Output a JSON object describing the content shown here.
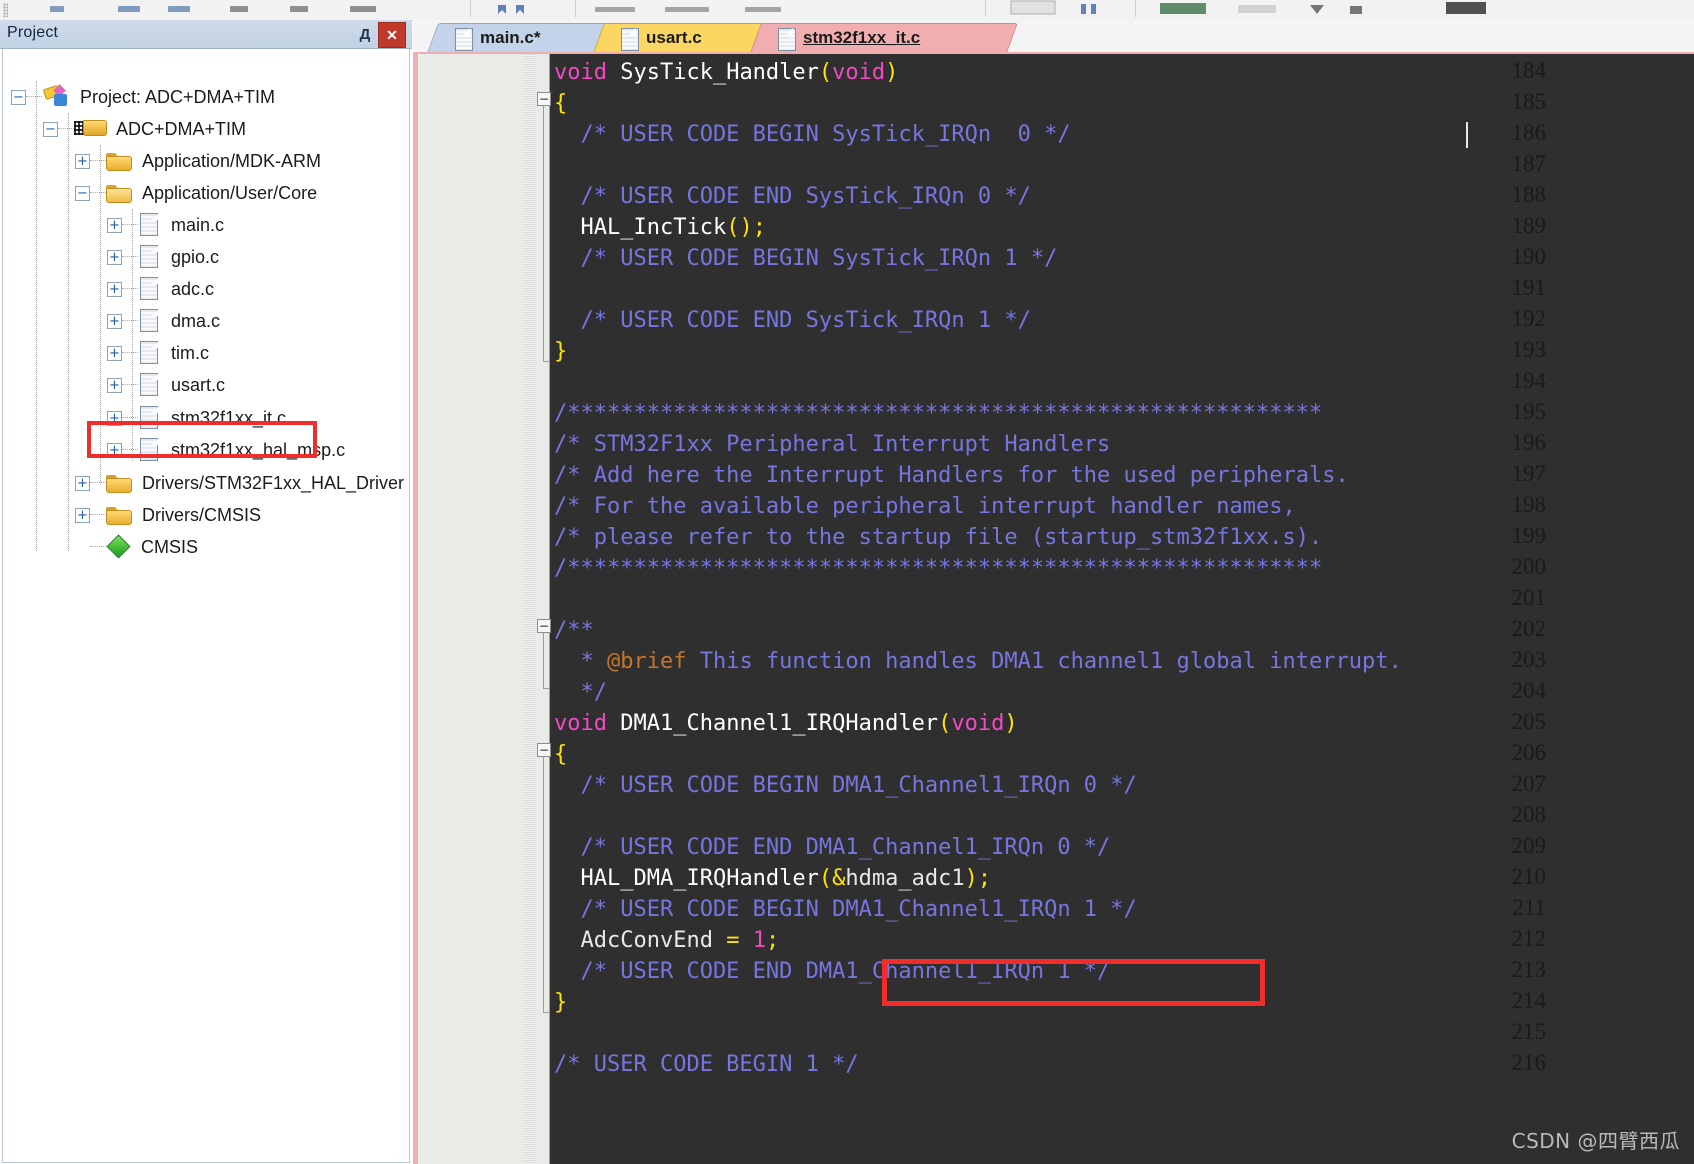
{
  "window": {
    "app": "Keil uVision MDK-ARM"
  },
  "toolbar": {
    "name": "main-toolbar-cropped"
  },
  "project_panel": {
    "title": "Project",
    "pin_label": "Д",
    "close_label": "✕",
    "pin_icon": "pin-icon",
    "close_icon": "close-icon",
    "tree": [
      {
        "label": "Project: ADC+DMA+TIM",
        "indent": 0,
        "expander": "−",
        "icon": "project-icon"
      },
      {
        "label": "ADC+DMA+TIM",
        "indent": 1,
        "expander": "−",
        "icon": "target-group-icon"
      },
      {
        "label": "Application/MDK-ARM",
        "indent": 2,
        "expander": "+",
        "icon": "folder-icon"
      },
      {
        "label": "Application/User/Core",
        "indent": 2,
        "expander": "−",
        "icon": "folder-open-icon"
      },
      {
        "label": "main.c",
        "indent": 3,
        "expander": "+",
        "icon": "file-icon"
      },
      {
        "label": "gpio.c",
        "indent": 3,
        "expander": "+",
        "icon": "file-icon"
      },
      {
        "label": "adc.c",
        "indent": 3,
        "expander": "+",
        "icon": "file-icon"
      },
      {
        "label": "dma.c",
        "indent": 3,
        "expander": "+",
        "icon": "file-icon"
      },
      {
        "label": "tim.c",
        "indent": 3,
        "expander": "+",
        "icon": "file-icon"
      },
      {
        "label": "usart.c",
        "indent": 3,
        "expander": "+",
        "icon": "file-icon"
      },
      {
        "label": "stm32f1xx_it.c",
        "indent": 3,
        "expander": "+",
        "icon": "file-icon"
      },
      {
        "label": "stm32f1xx_hal_msp.c",
        "indent": 3,
        "expander": "+",
        "icon": "file-icon"
      },
      {
        "label": "Drivers/STM32F1xx_HAL_Driver",
        "indent": 2,
        "expander": "+",
        "icon": "folder-icon"
      },
      {
        "label": "Drivers/CMSIS",
        "indent": 2,
        "expander": "+",
        "icon": "folder-icon"
      },
      {
        "label": "CMSIS",
        "indent": 2,
        "expander": "",
        "icon": "cmsis-diamond-icon"
      }
    ],
    "highlight": {
      "target": "stm32f1xx_it.c",
      "color": "#f22b2b"
    }
  },
  "editor": {
    "tabs": [
      {
        "label": "main.c*",
        "color": "#c3d3ea",
        "active": false,
        "icon": "file-icon"
      },
      {
        "label": "usart.c",
        "color": "#fcd663",
        "active": false,
        "icon": "file-icon"
      },
      {
        "label": "stm32f1xx_it.c",
        "color": "#f0aeb1",
        "active": true,
        "icon": "file-icon"
      }
    ],
    "theme": {
      "background": "#2f2f2f",
      "gutter_background": "#e9ebe7",
      "text": "#e8e8e8",
      "comment": "#7676e0",
      "keyword": "#f14ac4",
      "bracket": "#ffe400",
      "number": "#f14ac4",
      "doc_tag": "#c4742b"
    },
    "first_line": 184,
    "last_line": 216,
    "line_numbers": [
      184,
      185,
      186,
      187,
      188,
      189,
      190,
      191,
      192,
      193,
      194,
      195,
      196,
      197,
      198,
      199,
      200,
      201,
      202,
      203,
      204,
      205,
      206,
      207,
      208,
      209,
      210,
      211,
      212,
      213,
      214,
      215,
      216
    ],
    "lines": [
      {
        "n": 184,
        "text": "void SysTick_Handler(void)"
      },
      {
        "n": 185,
        "text": "{",
        "fold": "minus"
      },
      {
        "n": 186,
        "text": "  /* USER CODE BEGIN SysTick_IRQn 0 */"
      },
      {
        "n": 187,
        "text": ""
      },
      {
        "n": 188,
        "text": "  /* USER CODE END SysTick_IRQn 0 */"
      },
      {
        "n": 189,
        "text": "  HAL_IncTick();"
      },
      {
        "n": 190,
        "text": "  /* USER CODE BEGIN SysTick_IRQn 1 */"
      },
      {
        "n": 191,
        "text": ""
      },
      {
        "n": 192,
        "text": "  /* USER CODE END SysTick_IRQn 1 */"
      },
      {
        "n": 193,
        "text": "}",
        "fold": "end"
      },
      {
        "n": 194,
        "text": ""
      },
      {
        "n": 195,
        "text": "/*********************************************************"
      },
      {
        "n": 196,
        "text": "/* STM32F1xx Peripheral Interrupt Handlers"
      },
      {
        "n": 197,
        "text": "/* Add here the Interrupt Handlers for the used peripherals."
      },
      {
        "n": 198,
        "text": "/* For the available peripheral interrupt handler names,"
      },
      {
        "n": 199,
        "text": "/* please refer to the startup file (startup_stm32f1xx.s)."
      },
      {
        "n": 200,
        "text": "/*********************************************************"
      },
      {
        "n": 201,
        "text": ""
      },
      {
        "n": 202,
        "text": "/**",
        "fold": "minus"
      },
      {
        "n": 203,
        "text": "  * @brief This function handles DMA1 channel1 global interrupt."
      },
      {
        "n": 204,
        "text": "  */",
        "fold": "end"
      },
      {
        "n": 205,
        "text": "void DMA1_Channel1_IRQHandler(void)"
      },
      {
        "n": 206,
        "text": "{",
        "fold": "minus"
      },
      {
        "n": 207,
        "text": "  /* USER CODE BEGIN DMA1_Channel1_IRQn 0 */"
      },
      {
        "n": 208,
        "text": ""
      },
      {
        "n": 209,
        "text": "  /* USER CODE END DMA1_Channel1_IRQn 0 */"
      },
      {
        "n": 210,
        "text": "  HAL_DMA_IRQHandler(&hdma_adc1);"
      },
      {
        "n": 211,
        "text": "  /* USER CODE BEGIN DMA1_Channel1_IRQn 1 */"
      },
      {
        "n": 212,
        "text": "  AdcConvEnd = 1;"
      },
      {
        "n": 213,
        "text": "  /* USER CODE END DMA1_Channel1_IRQn 1 */"
      },
      {
        "n": 214,
        "text": "}"
      },
      {
        "n": 215,
        "text": ""
      },
      {
        "n": 216,
        "text": "/* USER CODE BEGIN 1 */"
      }
    ],
    "caret_line": 186,
    "highlight": {
      "target_line": 212,
      "target_text": "AdcConvEnd = 1;",
      "color": "#f22b2b"
    }
  },
  "watermark": {
    "text": "CSDN @四臂西瓜"
  }
}
